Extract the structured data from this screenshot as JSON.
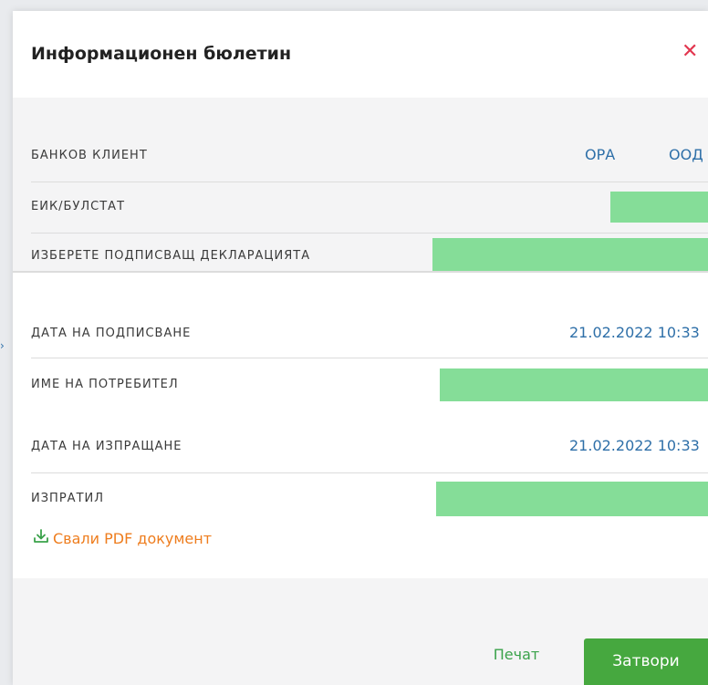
{
  "modal": {
    "title": "Информационен бюлетин",
    "close_icon": "close-icon"
  },
  "details": {
    "bank_client_label": "БАНКОВ КЛИЕНТ",
    "bank_client_value_1": "ОРА",
    "bank_client_value_2": "ООД",
    "eik_label": "ЕИК/БУЛСТАТ",
    "signer_label": "ИЗБЕРЕТЕ ПОДПИСВАЩ ДЕКЛАРАЦИЯТА",
    "sign_date_label": "ДАТА НА ПОДПИСВАНЕ",
    "sign_date_value": "21.02.2022 10:33",
    "username_label": "ИМЕ НА ПОТРЕБИТЕЛ",
    "send_date_label": "ДАТА НА ИЗПРАЩАНЕ",
    "send_date_value": "21.02.2022 10:33",
    "sender_label": "ИЗПРАТИЛ"
  },
  "download": {
    "label": "Свали PDF документ",
    "icon": "download-icon"
  },
  "footer": {
    "print_label": "Печат",
    "close_label": "Затвори"
  },
  "colors": {
    "accent_green": "#46a83f",
    "redacted_green": "#85dd98",
    "link_orange": "#ee7d1e",
    "value_blue": "#2e6fa8",
    "close_red": "#e2364f"
  }
}
